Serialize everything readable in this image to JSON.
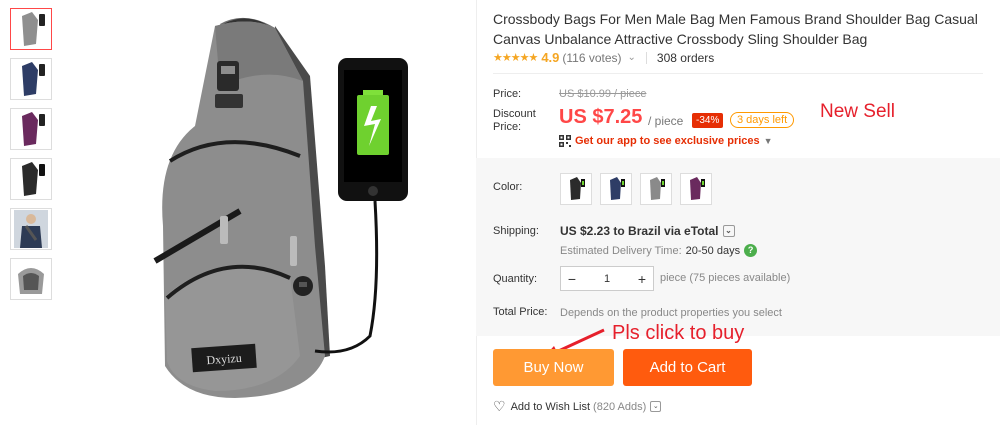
{
  "product": {
    "title": "Crossbody Bags For Men Male Bag Men Famous Brand Shoulder Bag Casual Canvas Unbalance Attractive Crossbody Sling Shoulder Bag",
    "rating": "4.9",
    "votes": "(116 votes)",
    "orders": "308 orders",
    "brand_label": "Dxyizu"
  },
  "price": {
    "label": "Price:",
    "original": "US $10.99 / piece",
    "discount_label": "Discount Price:",
    "discount": "US $7.25",
    "per_piece": "/ piece",
    "off_badge": "-34%",
    "days_left": "3 days left",
    "app_promo": "Get our app to see exclusive prices"
  },
  "annotations": {
    "new_sell": "New Sell",
    "click_to_buy": "Pls click to buy"
  },
  "color": {
    "label": "Color:",
    "swatches": [
      {
        "name": "black",
        "hex": "#2b2b2b"
      },
      {
        "name": "navy",
        "hex": "#2e3d66"
      },
      {
        "name": "gray",
        "hex": "#8a8a8a"
      },
      {
        "name": "purple",
        "hex": "#6a2a5e"
      }
    ]
  },
  "shipping": {
    "label": "Shipping:",
    "value": "US $2.23 to Brazil via eTotal",
    "estimate_label": "Estimated Delivery Time:",
    "estimate_days": "20-50 days"
  },
  "quantity": {
    "label": "Quantity:",
    "value": "1",
    "minus": "−",
    "plus": "+",
    "available": "piece (75 pieces available)"
  },
  "total": {
    "label": "Total Price:",
    "hint": "Depends on the product properties you select"
  },
  "actions": {
    "buy_now": "Buy Now",
    "add_to_cart": "Add to Cart",
    "wishlist": "Add to Wish List",
    "wishlist_count": "(820 Adds)"
  },
  "colors": {
    "accent_red": "#ff4747",
    "buy_now_bg": "#ff9933",
    "add_to_cart_bg": "#ff5b0e",
    "star": "#f5a623",
    "annotation_red": "#e6202c"
  }
}
